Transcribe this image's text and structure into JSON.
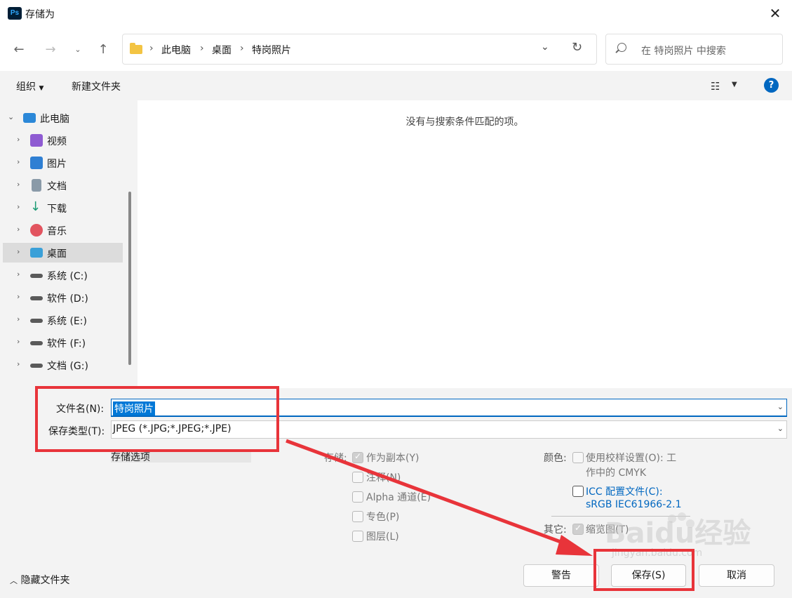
{
  "window": {
    "title": "存储为",
    "app_icon_text": "Ps"
  },
  "navigation": {
    "breadcrumb": [
      "此电脑",
      "桌面",
      "特岗照片"
    ],
    "search_placeholder": "在 特岗照片 中搜索"
  },
  "toolbar": {
    "organize": "组织",
    "new_folder": "新建文件夹"
  },
  "sidebar": {
    "items": [
      {
        "label": "此电脑",
        "icon": "computer-icon",
        "color": "#2b88d8"
      },
      {
        "label": "视频",
        "icon": "video-icon",
        "color": "#8e5bd2"
      },
      {
        "label": "图片",
        "icon": "picture-icon",
        "color": "#2f7fd3"
      },
      {
        "label": "文档",
        "icon": "document-icon",
        "color": "#8a9aa8"
      },
      {
        "label": "下载",
        "icon": "download-icon",
        "color": "#1a9a73"
      },
      {
        "label": "音乐",
        "icon": "music-icon",
        "color": "#e2545f"
      },
      {
        "label": "桌面",
        "icon": "desktop-icon",
        "color": "#3aa0d8"
      },
      {
        "label": "系统 (C:)",
        "icon": "windows-drive-icon",
        "color": "#555555"
      },
      {
        "label": "软件 (D:)",
        "icon": "drive-icon",
        "color": "#555555"
      },
      {
        "label": "系统 (E:)",
        "icon": "drive-icon",
        "color": "#555555"
      },
      {
        "label": "软件 (F:)",
        "icon": "drive-icon",
        "color": "#555555"
      },
      {
        "label": "文档 (G:)",
        "icon": "drive-icon",
        "color": "#555555"
      }
    ],
    "selected": "桌面"
  },
  "content": {
    "empty_message": "没有与搜索条件匹配的项。"
  },
  "form": {
    "filename_label": "文件名(N):",
    "filename_value": "特岗照片",
    "filetype_label": "保存类型(T):",
    "filetype_value": "JPEG (*.JPG;*.JPEG;*.JPE)"
  },
  "options": {
    "header": "存储选项",
    "storage_label": "存储:",
    "as_copy": "作为副本(Y)",
    "notes": "注释(N)",
    "alpha": "Alpha 通道(E)",
    "spot": "专色(P)",
    "layers": "图层(L)",
    "color_label": "颜色:",
    "proof_line1": "使用校样设置(O):  工",
    "proof_line2": "作中的 CMYK",
    "icc_line1": "ICC 配置文件(C):",
    "icc_line2": "sRGB IEC61966-2.1",
    "other_label": "其它:",
    "thumbnail": "缩览图(T)"
  },
  "footer": {
    "hide_folders": "隐藏文件夹",
    "warning": "警告",
    "save": "保存(S)",
    "cancel": "取消"
  },
  "watermark": {
    "brand": "Baidu经验",
    "url": "jingyan.baidu.com"
  },
  "colors": {
    "accent": "#0067c0",
    "annotation": "#e8343a"
  }
}
